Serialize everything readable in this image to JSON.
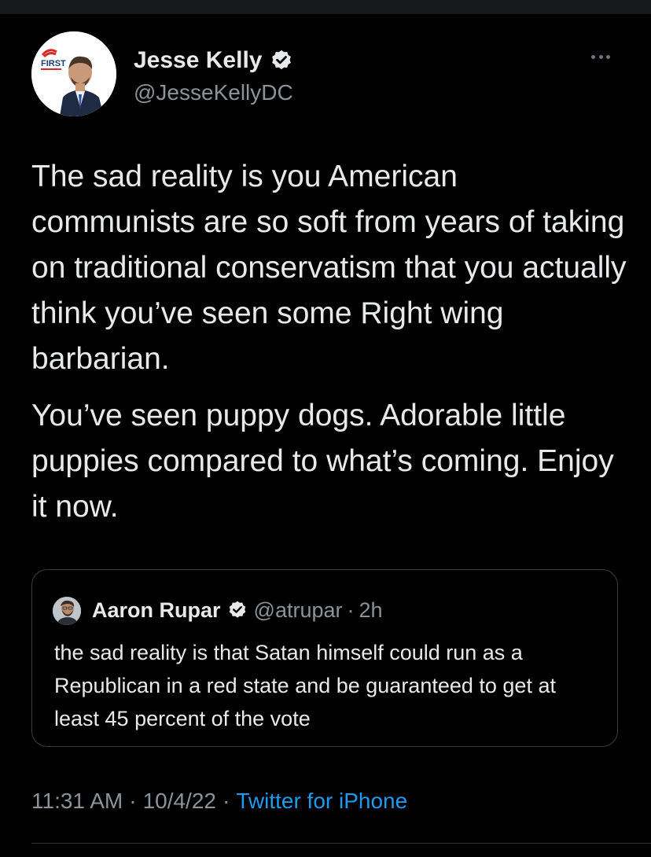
{
  "author": {
    "display_name": "Jesse Kelly",
    "handle": "@JesseKellyDC",
    "verified": true,
    "avatar_icon": "profile-photo-avatar",
    "avatar_logo_text": "THE FIRST"
  },
  "tweet": {
    "paragraphs": [
      "The sad reality is you American communists are so soft from years of taking on traditional conservatism that you actually think you’ve seen some Right wing barbarian.",
      "You’ve seen puppy dogs. Adorable little puppies compared to what’s coming. Enjoy it now."
    ]
  },
  "quoted_tweet": {
    "display_name": "Aaron Rupar",
    "handle": "@atrupar",
    "separator": "·",
    "time": "2h",
    "verified": true,
    "text": "the sad reality is that Satan himself could run as a Republican in a red state and be guaranteed to get at least 45 percent of the vote"
  },
  "meta": {
    "time": "11:31 AM",
    "separator": "·",
    "date": "10/4/22",
    "source": "Twitter for iPhone"
  },
  "colors": {
    "background": "#000000",
    "text_primary": "#e7e9ea",
    "text_secondary": "#8b9299",
    "link": "#1d9bf0",
    "verified_badge": "#e7e9ea",
    "border": "#3a3d41"
  }
}
